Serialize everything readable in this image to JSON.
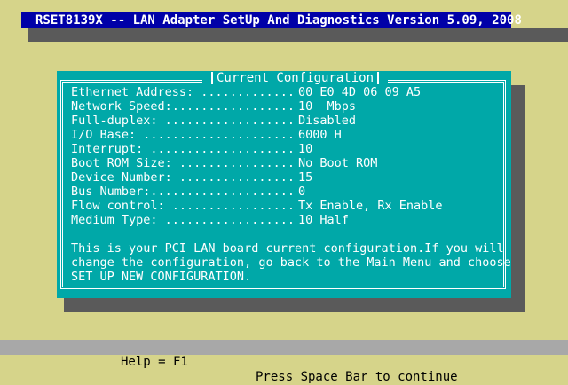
{
  "window": {
    "title": "RSET8139X -- LAN Adapter SetUp And Diagnostics Version 5.09, 2008"
  },
  "panel": {
    "title": "Current Configuration",
    "rows": [
      {
        "label": "Ethernet Address: .............",
        "value": "00 E0 4D 06 09 A5"
      },
      {
        "label": "Network Speed:.................",
        "value": "10  Mbps"
      },
      {
        "label": "Full-duplex: ..................",
        "value": "Disabled"
      },
      {
        "label": "I/O Base: .....................",
        "value": "6000 H"
      },
      {
        "label": "Interrupt: ....................",
        "value": "10"
      },
      {
        "label": "Boot ROM Size: ................",
        "value": "No Boot ROM"
      },
      {
        "label": "Device Number: ................",
        "value": "15"
      },
      {
        "label": "Bus Number:....................",
        "value": "0"
      },
      {
        "label": "Flow control: .................",
        "value": "Tx Enable, Rx Enable"
      },
      {
        "label": "Medium Type: ..................",
        "value": "10 Half"
      }
    ],
    "message": [
      "This is your PCI LAN board current configuration.If you will",
      "change the configuration, go back to the Main Menu and choose",
      "SET UP NEW CONFIGURATION."
    ]
  },
  "status_bar": {
    "help": "Help = F1",
    "continue": "Press Space Bar to continue"
  },
  "colors": {
    "desktop": "#d6d48a",
    "title_bar": "#0000a8",
    "panel": "#00a8a8",
    "status_bar": "#a8a8a8",
    "shadow": "#5a5a5a"
  }
}
